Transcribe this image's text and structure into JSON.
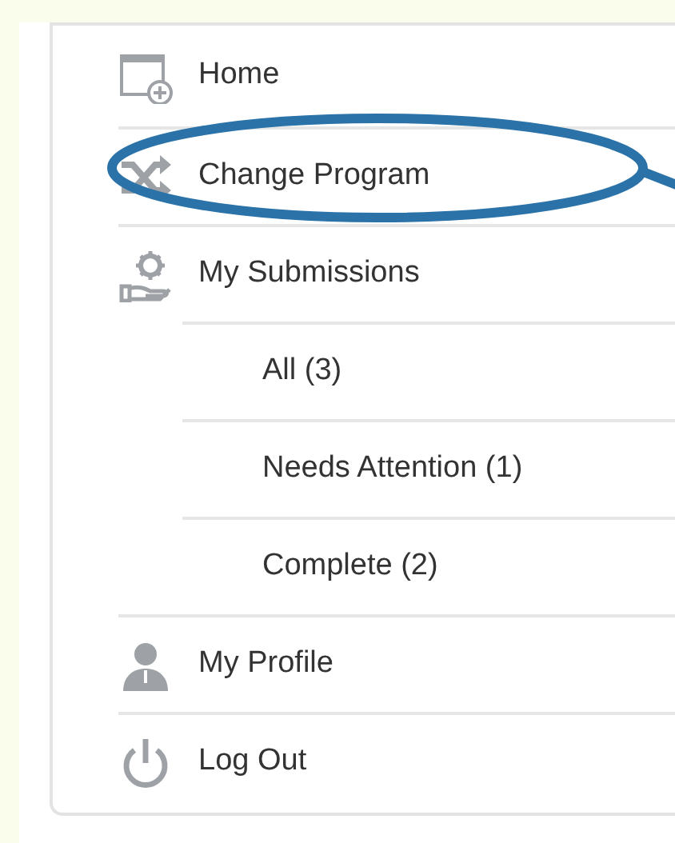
{
  "menu": [
    {
      "label": "Home",
      "kind": "home",
      "highlighted": false
    },
    {
      "label": "Change Program",
      "kind": "shuffle",
      "highlighted": true
    },
    {
      "label": "My Submissions",
      "kind": "submissions",
      "highlighted": false,
      "children": [
        {
          "label": "All (3)"
        },
        {
          "label": "Needs Attention (1)"
        },
        {
          "label": "Complete (2)"
        }
      ]
    },
    {
      "label": "My Profile",
      "kind": "profile",
      "highlighted": false
    },
    {
      "label": "Log Out",
      "kind": "power",
      "highlighted": false
    }
  ]
}
